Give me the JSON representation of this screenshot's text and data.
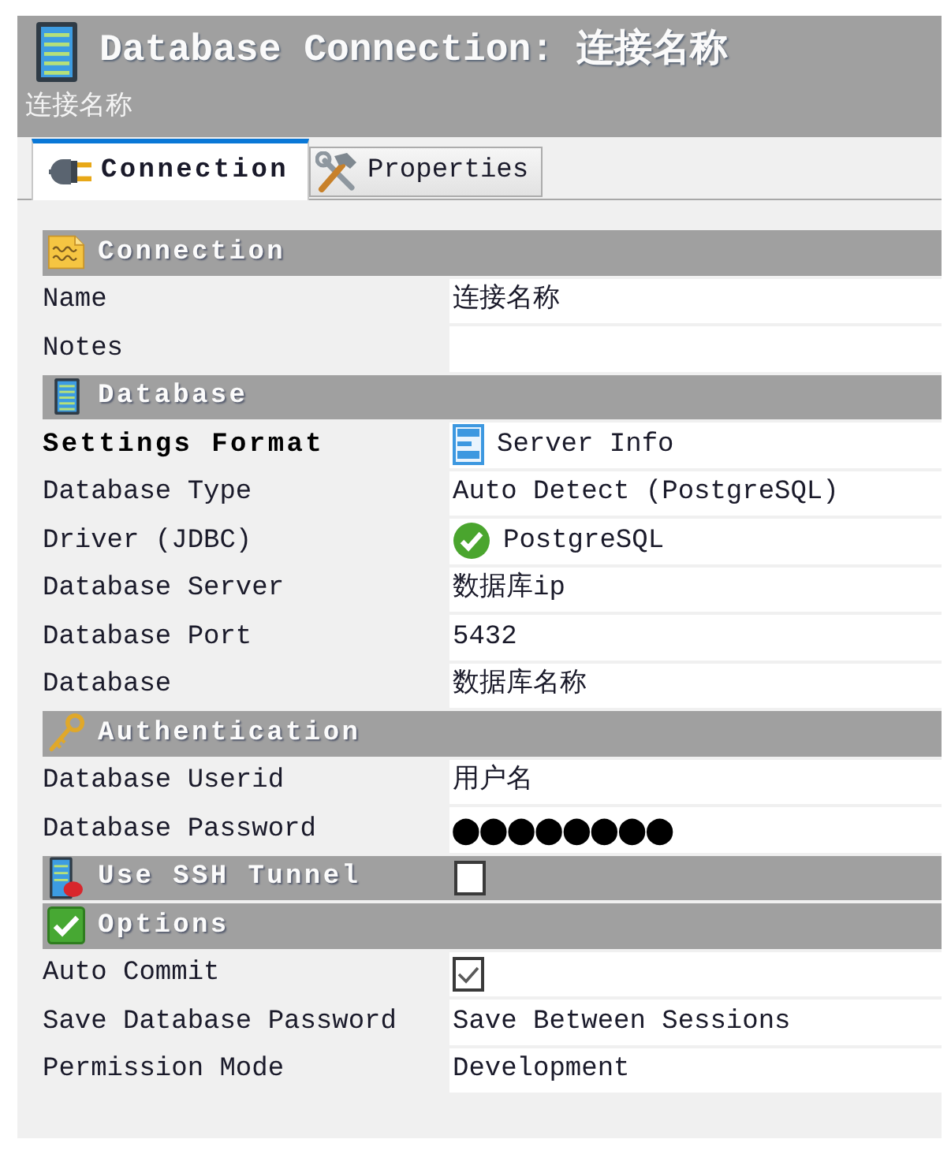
{
  "window": {
    "title": "Database Connection: 连接名称",
    "subtitle": "连接名称"
  },
  "tabs": [
    {
      "label": "Connection",
      "selected": true
    },
    {
      "label": "Properties",
      "selected": false
    }
  ],
  "sections": [
    {
      "kind": "group",
      "title": "Connection",
      "rows": [
        {
          "kind": "text",
          "label": "Name",
          "value": "连接名称",
          "bold": false
        },
        {
          "kind": "text",
          "label": "Notes",
          "bold": false
        }
      ]
    },
    {
      "kind": "group",
      "title": "Database",
      "rows": [
        {
          "kind": "format",
          "label": "Settings Format",
          "value": "Server Info",
          "bold": true
        },
        {
          "kind": "text",
          "label": "Database Type",
          "value": "Auto Detect (PostgreSQL)",
          "bold": false
        },
        {
          "kind": "driver",
          "label": "Driver (JDBC)",
          "value": "PostgreSQL",
          "bold": false
        },
        {
          "kind": "text",
          "label": "Database Server",
          "value": "数据库ip",
          "bold": false
        },
        {
          "kind": "text",
          "label": "Database Port",
          "value": "5432",
          "bold": false
        },
        {
          "kind": "text",
          "label": "Database",
          "value": "数据库名称",
          "bold": false
        }
      ]
    },
    {
      "kind": "group",
      "title": "Authentication",
      "rows": [
        {
          "kind": "text",
          "label": "Database Userid",
          "value": "用户名",
          "bold": false
        },
        {
          "kind": "password",
          "label": "Database Password",
          "value": "●●●●●●●●",
          "bold": false
        }
      ]
    },
    {
      "kind": "toggle",
      "title": "Use SSH Tunnel",
      "checked": false
    },
    {
      "kind": "group",
      "title": "Options",
      "rows": [
        {
          "kind": "checkbox",
          "label": "Auto Commit",
          "checked": true,
          "bold": false
        },
        {
          "kind": "text",
          "label": "Save Database Password",
          "value": "Save Between Sessions",
          "bold": false
        },
        {
          "kind": "text",
          "label": "Permission Mode",
          "value": "Development",
          "bold": false
        }
      ]
    }
  ]
}
